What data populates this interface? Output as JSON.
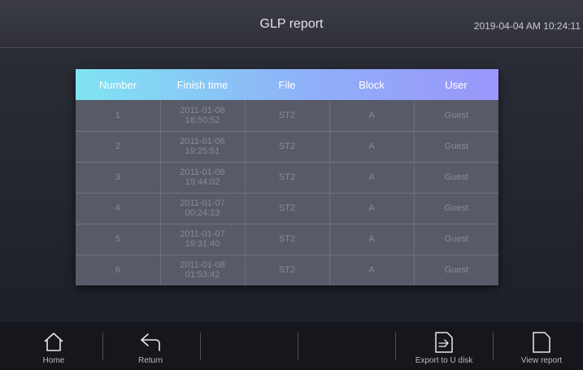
{
  "header": {
    "title": "GLP report",
    "datetime": "2019-04-04 AM 10:24:11"
  },
  "table": {
    "columns": [
      "Number",
      "Finish time",
      "File",
      "Block",
      "User"
    ],
    "rows": [
      [
        "1",
        "2011-01-06 18:50:52",
        "ST2",
        "A",
        "Guest"
      ],
      [
        "2",
        "2011-01-06 19:25:51",
        "ST2",
        "A",
        "Guest"
      ],
      [
        "3",
        "2011-01-06 19:44:02",
        "ST2",
        "A",
        "Guest"
      ],
      [
        "4",
        "2011-01-07 00:24:23",
        "ST2",
        "A",
        "Guest"
      ],
      [
        "5",
        "2011-01-07 19:31:40",
        "ST2",
        "A",
        "Guest"
      ],
      [
        "6",
        "2011-01-08 01:53:42",
        "ST2",
        "A",
        "Guest"
      ]
    ]
  },
  "footer": {
    "home": {
      "label": "Home",
      "icon": "home-icon"
    },
    "return": {
      "label": "Return",
      "icon": "return-arrow-icon"
    },
    "export": {
      "label": "Export to U disk",
      "icon": "export-file-icon"
    },
    "view_report": {
      "label": "View report",
      "icon": "document-icon"
    }
  },
  "colors": {
    "header_gradient_start": "#7fe4f2",
    "header_gradient_end": "#9a96fb",
    "row_background": "#585a68",
    "footer_background": "#16171d"
  }
}
